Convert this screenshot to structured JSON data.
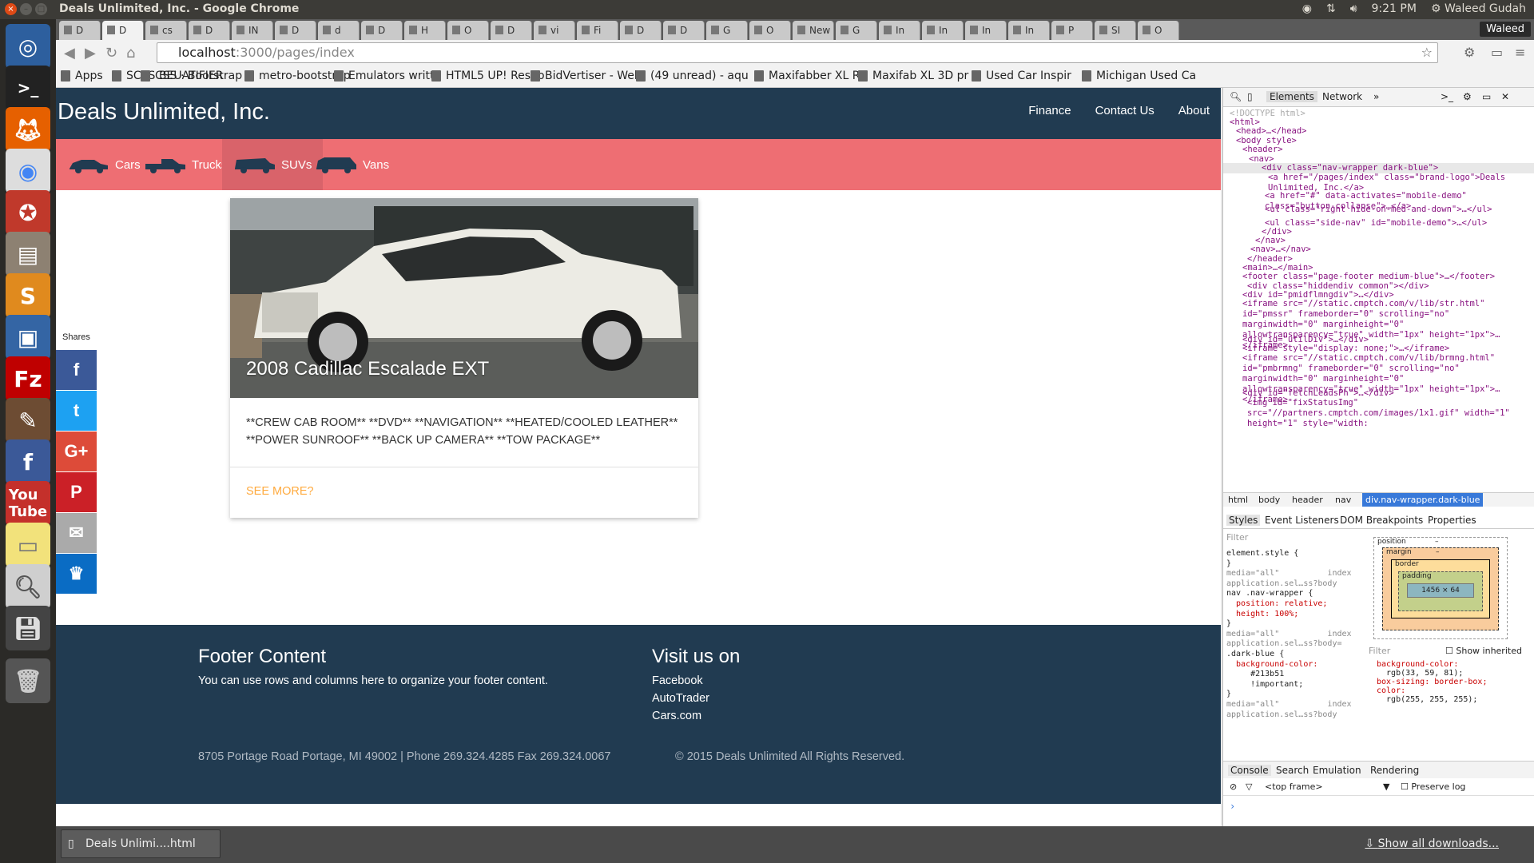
{
  "os_topbar": {
    "window_title": "Deals Unlimited, Inc. - Google Chrome",
    "time": "9:21 PM",
    "user": "Waleed Gudah"
  },
  "browser": {
    "tabs": [
      "D",
      "D",
      "cs",
      "D",
      "IN",
      "D",
      "d",
      "D",
      "H",
      "O",
      "D",
      "vi",
      "Fi",
      "D",
      "D",
      "G",
      "O",
      "New",
      "G",
      "In",
      "In",
      "In",
      "In",
      "P",
      "SI",
      "O"
    ],
    "profile": "Waleed",
    "url_host": "localhost",
    "url_path": ":3000/pages/index",
    "bookmarks": [
      "Apps",
      "SCSS BEUATIFIER",
      "CSS · Bootstrap",
      "metro-bootstrap",
      "Emulators writte",
      "HTML5 UP! Respo",
      "BidVertiser - Web",
      "(49 unread) - aqu",
      "Maxifabber XL Re",
      "Maxifab XL 3D pr",
      "Used Car Inspir",
      "Michigan Used Ca"
    ]
  },
  "site": {
    "brand": "Deals Unlimited, Inc.",
    "top_nav": [
      "Finance",
      "Contact Us",
      "About"
    ],
    "categories": [
      "Cars",
      "Trucks",
      "SUVs",
      "Vans"
    ],
    "active_category": "SUVs",
    "card": {
      "title": "2008 Cadillac Escalade EXT",
      "description": "**CREW CAB ROOM** **DVD** **NAVIGATION** **HEATED/COOLED LEATHER** **POWER SUNROOF** **BACK UP CAMERA** **TOW PACKAGE**",
      "link": "SEE MORE?"
    },
    "shares": {
      "label": "Shares",
      "buttons": [
        {
          "name": "facebook",
          "glyph": "f",
          "color": "#3b5998"
        },
        {
          "name": "twitter",
          "glyph": "t",
          "color": "#1da1f2"
        },
        {
          "name": "google-plus",
          "glyph": "G+",
          "color": "#dd4b39"
        },
        {
          "name": "pinterest",
          "glyph": "P",
          "color": "#cb2027"
        },
        {
          "name": "email",
          "glyph": "✉",
          "color": "#aaaaaa"
        },
        {
          "name": "sumome",
          "glyph": "♛",
          "color": "#0a6cc4"
        }
      ]
    },
    "footer": {
      "heading1": "Footer Content",
      "text1": "You can use rows and columns here to organize your footer content.",
      "heading2": "Visit us on",
      "links": [
        "Facebook",
        "AutoTrader",
        "Cars.com"
      ],
      "address": "8705 Portage Road Portage, MI 49002 | Phone 269.324.4285 Fax 269.324.0067",
      "copyright": "© 2015 Deals Unlimited All Rights Reserved."
    }
  },
  "devtools": {
    "tabs": [
      "Elements",
      "Network"
    ],
    "dom_lines": [
      "<!DOCTYPE html>",
      "<html>",
      "<head>…</head>",
      "<body style>",
      "<header>",
      "<nav>",
      "<div class=\"nav-wrapper dark-blue\">",
      "<a href=\"/pages/index\" class=\"brand-logo\">Deals Unlimited, Inc.</a>",
      "<a href=\"#\" data-activates=\"mobile-demo\" class=\"button-collapse\">…</a>",
      "<ul class=\"right hide-on-med-and-down\">…</ul>",
      "<ul class=\"side-nav\" id=\"mobile-demo\">…</ul>",
      "</div>",
      "</nav>",
      "<nav>…</nav>",
      "</header>",
      "<main>…</main>",
      "<footer class=\"page-footer medium-blue\">…</footer>",
      "<div class=\"hiddendiv common\"></div>",
      "<div id=\"pmidflmngdiv\">…</div>",
      "<iframe src=\"//static.cmptch.com/v/lib/str.html\" id=\"pmssr\" frameborder=\"0\" scrolling=\"no\" marginwidth=\"0\" marginheight=\"0\" allowtransparency=\"true\" width=\"1px\" height=\"1px\">…</iframe>",
      "<div id=\"utilDiv\">…</div>",
      "<iframe style=\"display: none;\">…</iframe>",
      "<iframe src=\"//static.cmptch.com/v/lib/brmng.html\" id=\"pmbrmng\" frameborder=\"0\" scrolling=\"no\" marginwidth=\"0\" marginheight=\"0\" allowtransparency=\"true\" width=\"1px\" height=\"1px\">…</iframe>",
      "<div id=\"fetchLeadsPh\">…</div>",
      "<img id=\"fixStatusImg\" src=\"//partners.cmptch.com/images/1x1.gif\" width=\"1\" height=\"1\" style=\"width:"
    ],
    "breadcrumbs": [
      "html",
      "body",
      "header",
      "nav",
      "div.nav-wrapper.dark-blue"
    ],
    "styles_tabs": [
      "Styles",
      "Event Listeners",
      "DOM Breakpoints",
      "Properties"
    ],
    "filter": "Filter",
    "styles_rules": [
      "element.style {",
      "}",
      "media=\"all\"          index",
      "application.sel…ss?body",
      "nav .nav-wrapper {",
      "  position: relative;",
      "  height: 100%;",
      "}",
      "media=\"all\"          index",
      "application.sel…ss?body=",
      ".dark-blue {",
      "  background-color:",
      "     #213b51",
      "     !important;",
      "}",
      "media=\"all\"          index",
      "application.sel…ss?body"
    ],
    "box_model": {
      "position": "position",
      "margin": "margin",
      "border": "border",
      "padding": "padding",
      "content": "1456 × 64",
      "dash": "–"
    },
    "computed": {
      "show_inherited": "Show inherited",
      "lines": [
        "background-color:",
        "  rgb(33, 59, 81);",
        "box-sizing: border-box;",
        "color:",
        "  rgb(255, 255, 255);"
      ]
    },
    "console_tabs": [
      "Console",
      "Search",
      "Emulation",
      "Rendering"
    ],
    "frame": "<top frame>",
    "preserve_log": "Preserve log"
  },
  "downloads": {
    "item": "Deals Unlimi....html",
    "show_all": "Show all downloads..."
  }
}
